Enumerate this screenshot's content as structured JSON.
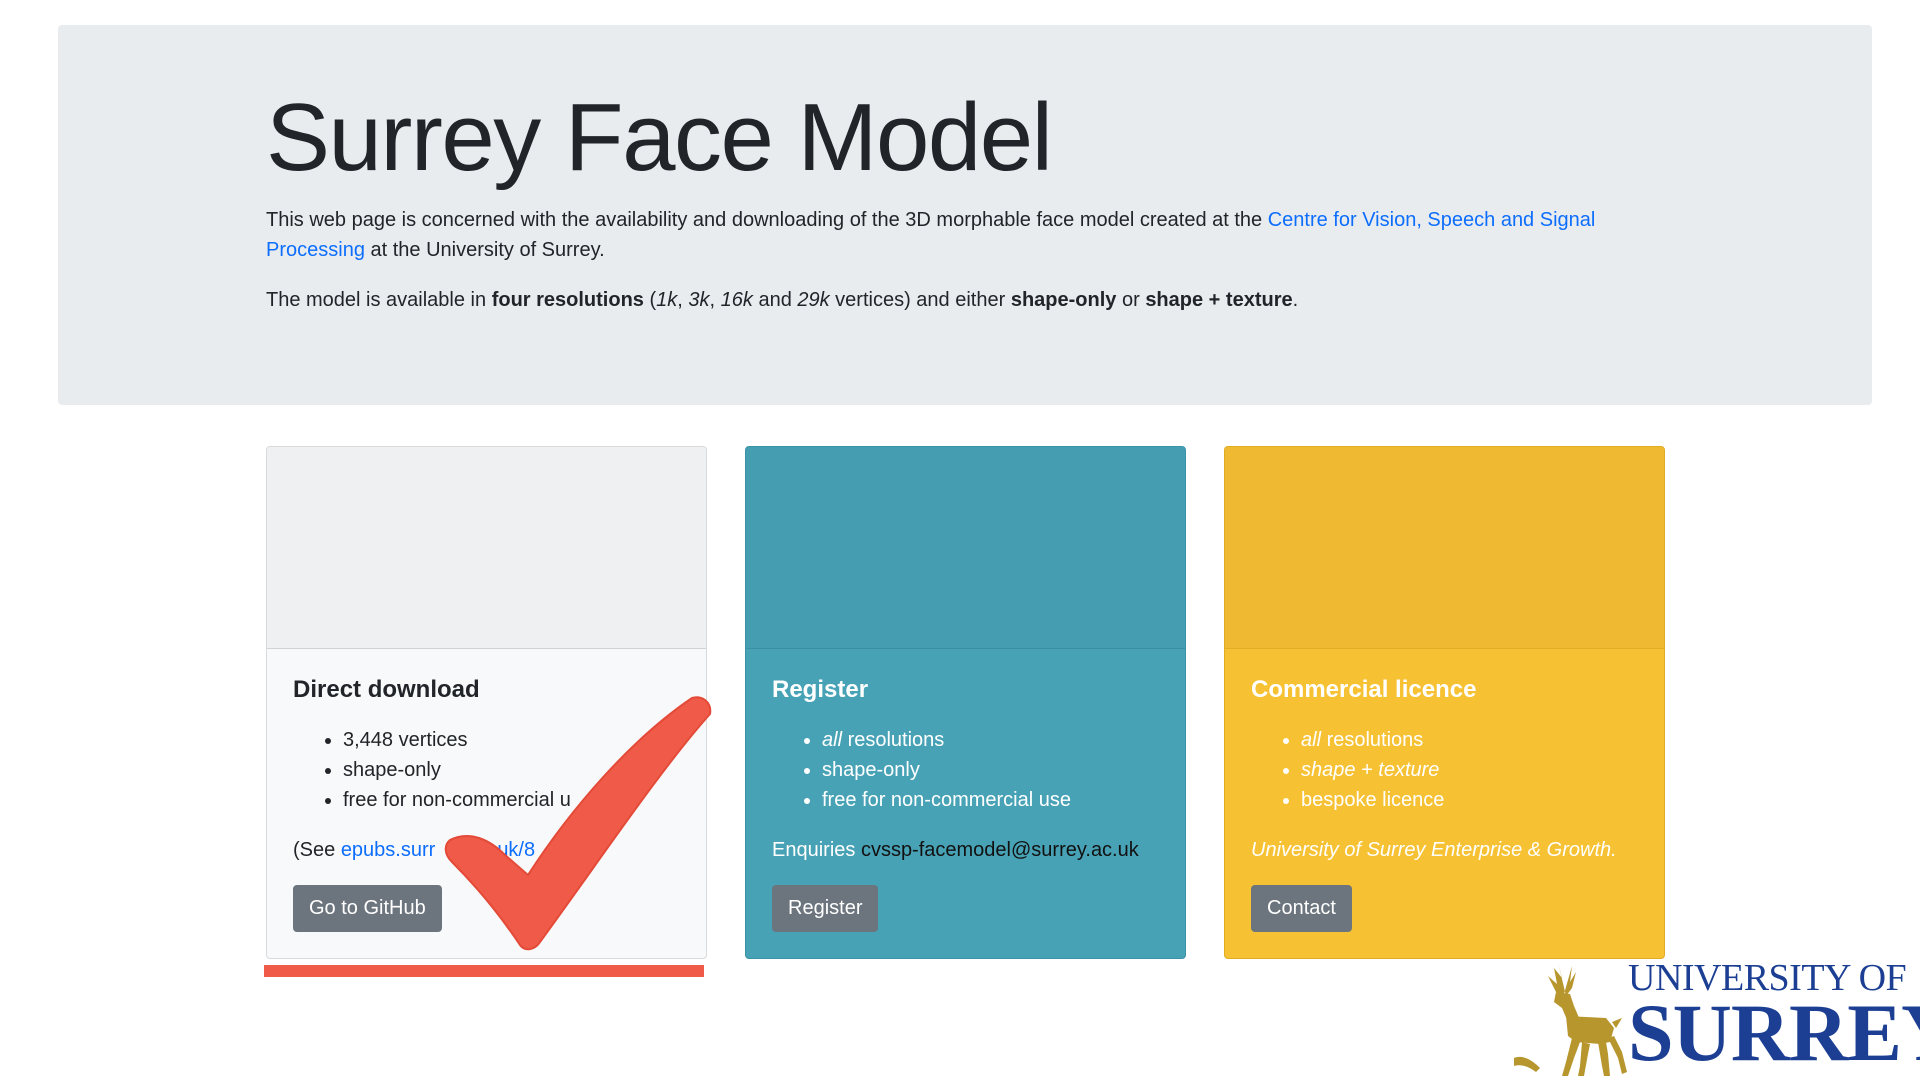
{
  "jumbotron": {
    "title": "Surrey Face Model",
    "intro_text": "This web page is concerned with the availability and downloading of the 3D morphable face model created at the ",
    "intro_link": "Centre for Vision, Speech and Signal Processing",
    "intro_suffix": " at the University of Surrey.",
    "model_prefix": "The model is available in ",
    "model_bold1": "four resolutions",
    "model_paren_open": " (",
    "res1": "1k",
    "sep1": ", ",
    "res2": "3k",
    "sep2": ", ",
    "res3": "16k",
    "and": " and ",
    "res4": "29k",
    "vertices_either": " vertices) and either ",
    "model_bold2": "shape-only",
    "or": " or ",
    "model_bold3": "shape + texture",
    "period": "."
  },
  "cards": {
    "direct": {
      "title": "Direct download",
      "items": [
        "3,448 vertices",
        "shape-only",
        "free for non-commercial u"
      ],
      "see_prefix": "(See ",
      "see_link": "epubs.surr",
      "see_link_tail": "uk/8",
      "see_suffix": ")",
      "button": "Go to GitHub"
    },
    "register": {
      "title": "Register",
      "item1_em": "all",
      "item1_rest": " resolutions",
      "item2": "shape-only",
      "item3": "free for non-commercial use",
      "enquiries_label": "Enquiries ",
      "email": "cvssp-facemodel@surrey.ac.uk",
      "button": "Register"
    },
    "commercial": {
      "title": "Commercial licence",
      "item1_em": "all",
      "item1_rest": " resolutions",
      "item2": "shape + texture",
      "item3": "bespoke licence",
      "note": "University of Surrey Enterprise & Growth.",
      "button": "Contact"
    }
  },
  "logo": {
    "line1": "UNIVERSITY OF",
    "line2": "SURREY"
  },
  "colors": {
    "jumbotron_bg": "#e9ecef",
    "register_card": "#48a2b6",
    "commercial_card": "#f6c132",
    "button_gray": "#6c757d",
    "link_blue": "#0d6efd",
    "annotation_red": "#f05a48",
    "logo_blue": "#1c3f94",
    "logo_gold": "#b8962e"
  }
}
